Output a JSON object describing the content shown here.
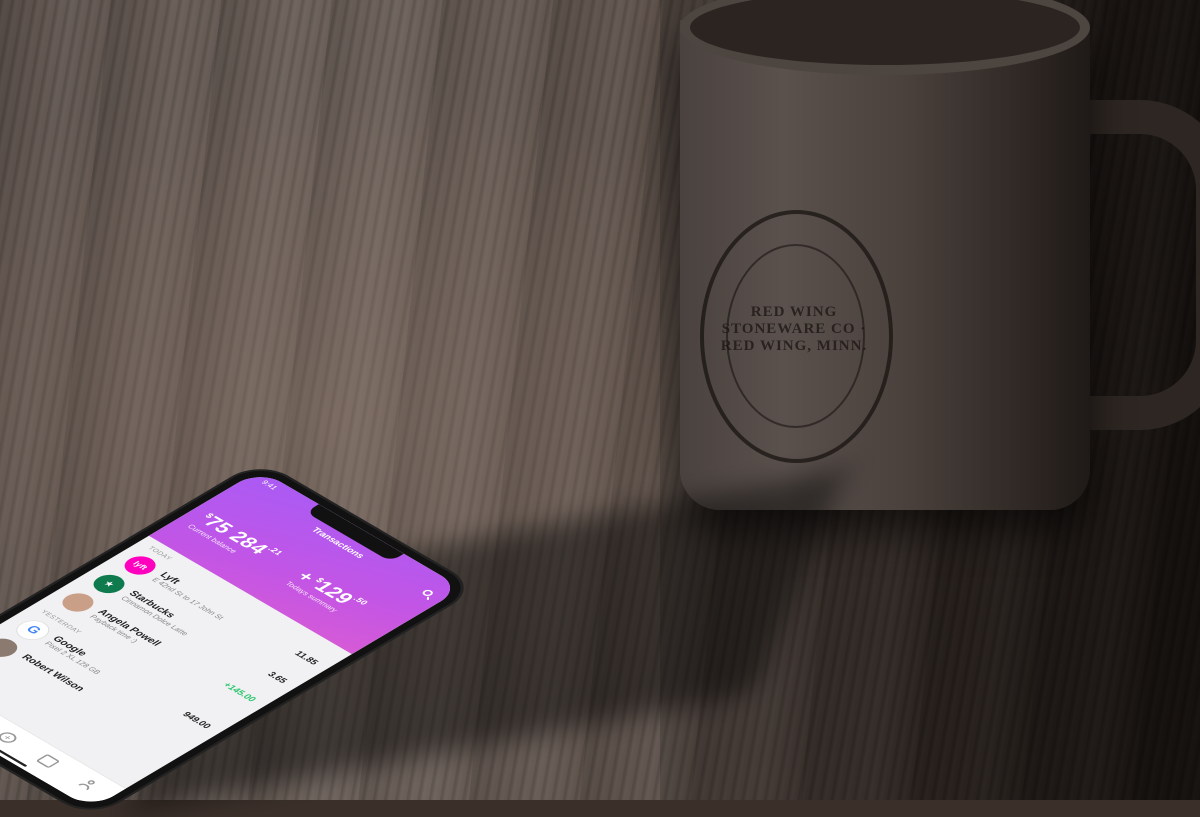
{
  "scene": {
    "mug_label": "RED WING STONEWARE CO · RED WING, MINN."
  },
  "app": {
    "status_time": "9:41",
    "header_title": "Transactions",
    "balance": {
      "currency": "$",
      "whole": "75 284",
      "cents": ".21",
      "caption": "Current balance"
    },
    "summary": {
      "sign": "+",
      "currency": "$",
      "whole": "129",
      "cents": ".50",
      "caption": "Todays summary"
    },
    "sections": [
      {
        "label": "TODAY",
        "items": [
          {
            "name": "Lyft",
            "detail": "E 42nd St to 17 John St",
            "amount": "11.85",
            "positive": false,
            "logo": "lyft-logo",
            "color": "#ff00bf"
          },
          {
            "name": "Starbucks",
            "detail": "Cinnamon Dolce Latte",
            "amount": "3.65",
            "positive": false,
            "logo": "starbucks-logo",
            "color": "#0f7a4e"
          },
          {
            "name": "Angela Powell",
            "detail": "Payback time :)",
            "amount": "+145.00",
            "positive": true,
            "logo": "avatar",
            "color": "#c99f88"
          }
        ]
      },
      {
        "label": "YESTERDAY",
        "items": [
          {
            "name": "Google",
            "detail": "Pixel 2 XL 128 GB",
            "amount": "949.00",
            "positive": false,
            "logo": "google-logo",
            "color": "#ffffff"
          },
          {
            "name": "Robert Wilson",
            "detail": "",
            "amount": "",
            "positive": false,
            "logo": "avatar",
            "color": "#8a7a70"
          }
        ]
      }
    ],
    "tabs": [
      "transactions",
      "stats",
      "add",
      "wallet",
      "profile"
    ]
  }
}
